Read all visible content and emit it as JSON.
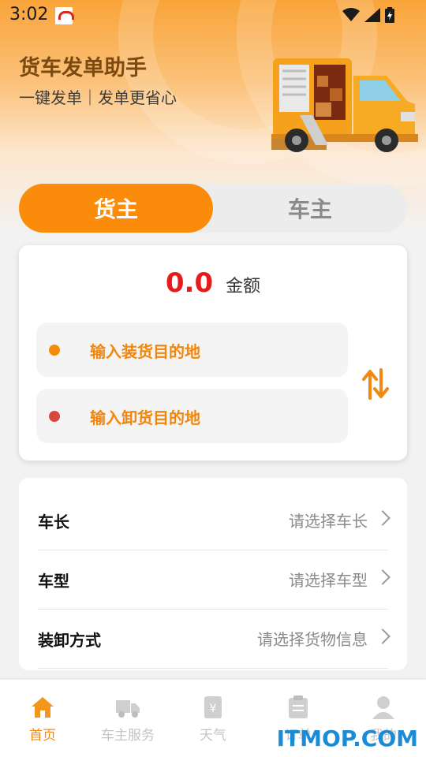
{
  "status_bar": {
    "time": "3:02"
  },
  "header": {
    "title": "货车发单助手",
    "subtitle": "一键发单｜发单更省心"
  },
  "role_tabs": [
    {
      "label": "货主",
      "active": true
    },
    {
      "label": "车主",
      "active": false
    }
  ],
  "order_card": {
    "amount_value": "0.0",
    "amount_label": "金额",
    "load_address_placeholder": "输入装货目的地",
    "unload_address_placeholder": "输入卸货目的地",
    "load_dot_color": "#f58b0b",
    "unload_dot_color": "#d9473f"
  },
  "form_rows": [
    {
      "label": "车长",
      "placeholder": "请选择车长"
    },
    {
      "label": "车型",
      "placeholder": "请选择车型"
    },
    {
      "label": "装卸方式",
      "placeholder": "请选择货物信息"
    }
  ],
  "bottom_nav": [
    {
      "label": "首页",
      "icon": "home-icon",
      "active": true
    },
    {
      "label": "车主服务",
      "icon": "truck-icon",
      "active": false
    },
    {
      "label": "天气",
      "icon": "weather-icon",
      "active": false
    },
    {
      "label": "订单",
      "icon": "order-icon",
      "active": false
    },
    {
      "label": "我的",
      "icon": "profile-icon",
      "active": false
    }
  ],
  "watermark": "ITMOP.COM",
  "colors": {
    "accent": "#fb8c0b",
    "amount": "#e81b1b",
    "inactive_nav": "#c4c4c4"
  }
}
